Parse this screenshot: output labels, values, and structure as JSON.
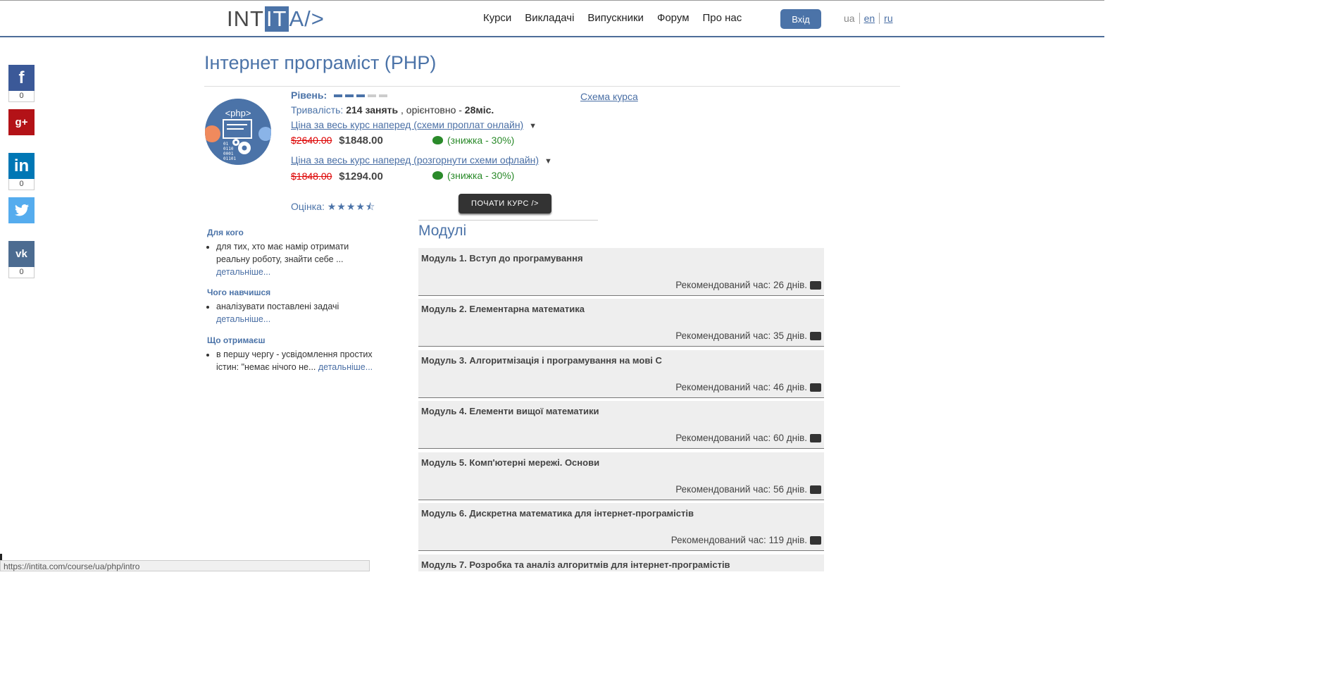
{
  "header": {
    "logo": {
      "part1": "INT",
      "part2": "IT",
      "part3": "A/>"
    },
    "nav": [
      "Курси",
      "Викладачі",
      "Випускники",
      "Форум",
      "Про нас"
    ],
    "login_label": "Вхід",
    "langs": [
      "ua",
      "en",
      "ru"
    ]
  },
  "social": [
    {
      "icon": "f",
      "count": "0",
      "color": "#3b5998"
    },
    {
      "icon": "g+",
      "count": "",
      "color": "#b31217"
    },
    {
      "icon": "in",
      "count": "0",
      "color": "#0077b5"
    },
    {
      "icon": "t",
      "count": "",
      "color": "#55acee"
    },
    {
      "icon": "vk",
      "count": "0",
      "color": "#4c6c91"
    }
  ],
  "course": {
    "title": "Інтернет програміст (PHP)",
    "image_label": "<php>",
    "level_label": "Рівень:",
    "level": 3,
    "level_max": 5,
    "duration_prefix": "Тривалість:",
    "duration_lessons": "214 занять",
    "duration_mid": ", орієнтовно -",
    "duration_months": "28міс.",
    "schema_link": "Схема курса",
    "price_online_link": "Ціна за весь курс наперед (схеми проплат онлайн)",
    "price_online_old": "$2640.00",
    "price_online_new": "$1848.00",
    "price_online_discount": "(знижка - 30%)",
    "price_offline_link": "Ціна за весь курс наперед (розгорнути схеми офлайн)",
    "price_offline_old": "$1848.00",
    "price_offline_new": "$1294.00",
    "price_offline_discount": "(знижка - 30%)",
    "rating_label": "Оцінка:",
    "rating_stars": "★★★★⯪",
    "start_label": "ПОЧАТИ КУРС />"
  },
  "about": {
    "for_whom_title": "Для кого",
    "for_whom_text": "для тих, хто має намір отримати реальну роботу, знайти себе ...",
    "learn_title": "Чого навчишся",
    "learn_text": "аналізувати поставлені задачі",
    "get_title": "Що отримаєш",
    "get_text": "в першу чергу - усвідомлення простих істин: \"немає нічого не...",
    "more_link": "детальніше..."
  },
  "modules_title": "Модулі",
  "modules": [
    {
      "name": "Модуль 1. Вступ до програмування",
      "time": "Рекомендований час: 26 днів."
    },
    {
      "name": "Модуль 2. Елементарна математика",
      "time": "Рекомендований час: 35 днів."
    },
    {
      "name": "Модуль 3. Алгоритмізація і програмування на мові С",
      "time": "Рекомендований час: 46 днів."
    },
    {
      "name": "Модуль 4. Елементи вищої математики",
      "time": "Рекомендований час: 60 днів."
    },
    {
      "name": "Модуль 5. Комп'ютерні мережі. Основи",
      "time": "Рекомендований час: 56 днів."
    },
    {
      "name": "Модуль 6. Дискретна математика для інтернет-програмістів",
      "time": "Рекомендований час: 119 днів."
    },
    {
      "name": "Модуль 7. Розробка та аналіз алгоритмів для інтернет-програмістів",
      "time": ""
    }
  ],
  "statusbar": "https://intita.com/course/ua/php/intro"
}
